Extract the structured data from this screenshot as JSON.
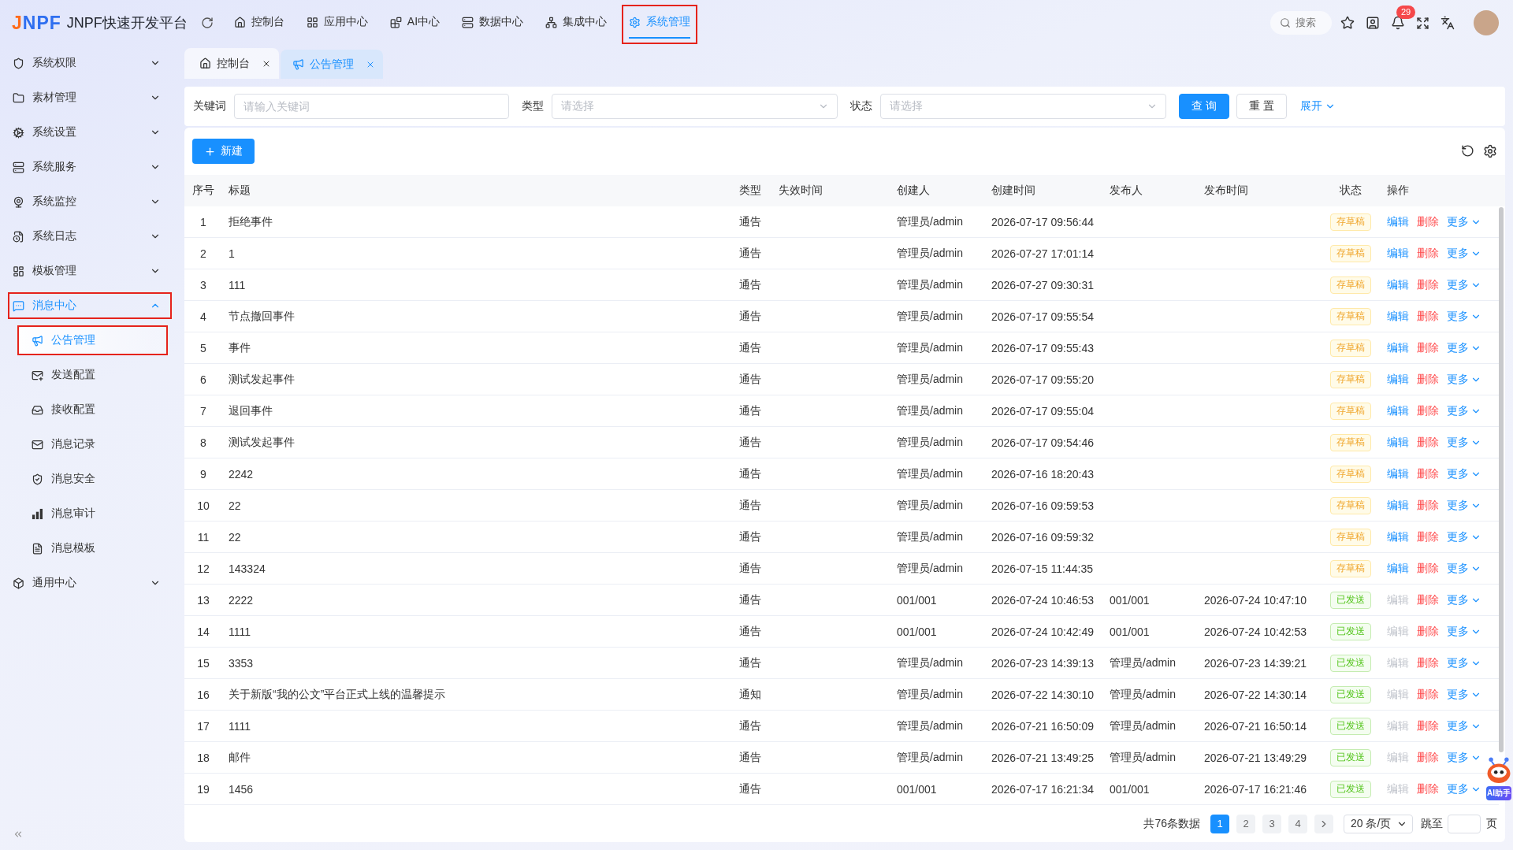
{
  "header": {
    "logo": "JNPF",
    "title": "JNPF快速开发平台",
    "nav": [
      {
        "label": "控制台",
        "selected": false,
        "highlighted": false
      },
      {
        "label": "应用中心",
        "selected": false,
        "highlighted": false
      },
      {
        "label": "AI中心",
        "selected": false,
        "highlighted": false
      },
      {
        "label": "数据中心",
        "selected": false,
        "highlighted": false
      },
      {
        "label": "集成中心",
        "selected": false,
        "highlighted": false
      },
      {
        "label": "系统管理",
        "selected": true,
        "highlighted": true
      }
    ],
    "search": {
      "label": "搜索"
    },
    "notification_count": "29"
  },
  "tabs": [
    {
      "label": "控制台",
      "selected": false
    },
    {
      "label": "公告管理",
      "selected": true
    }
  ],
  "sidebar": {
    "items": [
      {
        "label": "系统权限",
        "selected": false,
        "expanded": false,
        "highlighted": false
      },
      {
        "label": "素材管理",
        "selected": false,
        "expanded": false,
        "highlighted": false
      },
      {
        "label": "系统设置",
        "selected": false,
        "expanded": false,
        "highlighted": false
      },
      {
        "label": "系统服务",
        "selected": false,
        "expanded": false,
        "highlighted": false
      },
      {
        "label": "系统监控",
        "selected": false,
        "expanded": false,
        "highlighted": false
      },
      {
        "label": "系统日志",
        "selected": false,
        "expanded": false,
        "highlighted": false
      },
      {
        "label": "模板管理",
        "selected": false,
        "expanded": false,
        "highlighted": false
      },
      {
        "label": "消息中心",
        "selected": true,
        "expanded": true,
        "highlighted": true,
        "children": [
          {
            "label": "公告管理",
            "selected": true,
            "highlighted": true
          },
          {
            "label": "发送配置",
            "selected": false,
            "highlighted": false
          },
          {
            "label": "接收配置",
            "selected": false,
            "highlighted": false
          },
          {
            "label": "消息记录",
            "selected": false,
            "highlighted": false
          },
          {
            "label": "消息安全",
            "selected": false,
            "highlighted": false
          },
          {
            "label": "消息审计",
            "selected": false,
            "highlighted": false
          },
          {
            "label": "消息模板",
            "selected": false,
            "highlighted": false
          }
        ]
      },
      {
        "label": "通用中心",
        "selected": false,
        "expanded": false,
        "highlighted": false
      }
    ]
  },
  "filters": {
    "fields": [
      {
        "kind": "input",
        "label": "关键词",
        "placeholder": "请输入关键词"
      },
      {
        "kind": "select",
        "label": "类型",
        "placeholder": "请选择"
      },
      {
        "kind": "select",
        "label": "状态",
        "placeholder": "请选择"
      }
    ],
    "buttons": [
      {
        "kind": "primary",
        "label": "查 询"
      },
      {
        "kind": "default",
        "label": "重 置"
      }
    ],
    "expand": "展开"
  },
  "toolbar": {
    "new_button": "新建"
  },
  "table": {
    "columns": [
      "序号",
      "标题",
      "类型",
      "失效时间",
      "创建人",
      "创建时间",
      "发布人",
      "发布时间",
      "状态",
      "操作"
    ],
    "rows": [
      {
        "no": "1",
        "title": "拒绝事件",
        "type": "通告",
        "creator": "管理员/admin",
        "created": "2026-07-17 09:56:44",
        "status": {
          "label": "存草稿",
          "kind": "draft"
        },
        "edit": {
          "label": "编辑",
          "disabled": false
        },
        "delete": "删除",
        "more": "更多"
      },
      {
        "no": "2",
        "title": "1",
        "type": "通告",
        "creator": "管理员/admin",
        "created": "2026-07-27 17:01:14",
        "status": {
          "label": "存草稿",
          "kind": "draft"
        },
        "edit": {
          "label": "编辑",
          "disabled": false
        },
        "delete": "删除",
        "more": "更多"
      },
      {
        "no": "3",
        "title": "111",
        "type": "通告",
        "creator": "管理员/admin",
        "created": "2026-07-27 09:30:31",
        "status": {
          "label": "存草稿",
          "kind": "draft"
        },
        "edit": {
          "label": "编辑",
          "disabled": false
        },
        "delete": "删除",
        "more": "更多"
      },
      {
        "no": "4",
        "title": "节点撤回事件",
        "type": "通告",
        "creator": "管理员/admin",
        "created": "2026-07-17 09:55:54",
        "status": {
          "label": "存草稿",
          "kind": "draft"
        },
        "edit": {
          "label": "编辑",
          "disabled": false
        },
        "delete": "删除",
        "more": "更多"
      },
      {
        "no": "5",
        "title": "事件",
        "type": "通告",
        "creator": "管理员/admin",
        "created": "2026-07-17 09:55:43",
        "status": {
          "label": "存草稿",
          "kind": "draft"
        },
        "edit": {
          "label": "编辑",
          "disabled": false
        },
        "delete": "删除",
        "more": "更多"
      },
      {
        "no": "6",
        "title": "测试发起事件",
        "type": "通告",
        "creator": "管理员/admin",
        "created": "2026-07-17 09:55:20",
        "status": {
          "label": "存草稿",
          "kind": "draft"
        },
        "edit": {
          "label": "编辑",
          "disabled": false
        },
        "delete": "删除",
        "more": "更多"
      },
      {
        "no": "7",
        "title": "退回事件",
        "type": "通告",
        "creator": "管理员/admin",
        "created": "2026-07-17 09:55:04",
        "status": {
          "label": "存草稿",
          "kind": "draft"
        },
        "edit": {
          "label": "编辑",
          "disabled": false
        },
        "delete": "删除",
        "more": "更多"
      },
      {
        "no": "8",
        "title": "测试发起事件",
        "type": "通告",
        "creator": "管理员/admin",
        "created": "2026-07-17 09:54:46",
        "status": {
          "label": "存草稿",
          "kind": "draft"
        },
        "edit": {
          "label": "编辑",
          "disabled": false
        },
        "delete": "删除",
        "more": "更多"
      },
      {
        "no": "9",
        "title": "2242",
        "type": "通告",
        "creator": "管理员/admin",
        "created": "2026-07-16 18:20:43",
        "status": {
          "label": "存草稿",
          "kind": "draft"
        },
        "edit": {
          "label": "编辑",
          "disabled": false
        },
        "delete": "删除",
        "more": "更多"
      },
      {
        "no": "10",
        "title": "22",
        "type": "通告",
        "creator": "管理员/admin",
        "created": "2026-07-16 09:59:53",
        "status": {
          "label": "存草稿",
          "kind": "draft"
        },
        "edit": {
          "label": "编辑",
          "disabled": false
        },
        "delete": "删除",
        "more": "更多"
      },
      {
        "no": "11",
        "title": "22",
        "type": "通告",
        "creator": "管理员/admin",
        "created": "2026-07-16 09:59:32",
        "status": {
          "label": "存草稿",
          "kind": "draft"
        },
        "edit": {
          "label": "编辑",
          "disabled": false
        },
        "delete": "删除",
        "more": "更多"
      },
      {
        "no": "12",
        "title": "143324",
        "type": "通告",
        "creator": "管理员/admin",
        "created": "2026-07-15 11:44:35",
        "status": {
          "label": "存草稿",
          "kind": "draft"
        },
        "edit": {
          "label": "编辑",
          "disabled": false
        },
        "delete": "删除",
        "more": "更多"
      },
      {
        "no": "13",
        "title": "2222",
        "type": "通告",
        "creator": "001/001",
        "created": "2026-07-24 10:46:53",
        "publisher": "001/001",
        "published": "2026-07-24 10:47:10",
        "status": {
          "label": "已发送",
          "kind": "sent"
        },
        "edit": {
          "label": "编辑",
          "disabled": true
        },
        "delete": "删除",
        "more": "更多"
      },
      {
        "no": "14",
        "title": "1111",
        "type": "通告",
        "creator": "001/001",
        "created": "2026-07-24 10:42:49",
        "publisher": "001/001",
        "published": "2026-07-24 10:42:53",
        "status": {
          "label": "已发送",
          "kind": "sent"
        },
        "edit": {
          "label": "编辑",
          "disabled": true
        },
        "delete": "删除",
        "more": "更多"
      },
      {
        "no": "15",
        "title": "3353",
        "type": "通告",
        "creator": "管理员/admin",
        "created": "2026-07-23 14:39:13",
        "publisher": "管理员/admin",
        "published": "2026-07-23 14:39:21",
        "status": {
          "label": "已发送",
          "kind": "sent"
        },
        "edit": {
          "label": "编辑",
          "disabled": true
        },
        "delete": "删除",
        "more": "更多"
      },
      {
        "no": "16",
        "title": "关于新版“我的公文”平台正式上线的温馨提示",
        "type": "通知",
        "creator": "管理员/admin",
        "created": "2026-07-22 14:30:10",
        "publisher": "管理员/admin",
        "published": "2026-07-22 14:30:14",
        "status": {
          "label": "已发送",
          "kind": "sent"
        },
        "edit": {
          "label": "编辑",
          "disabled": true
        },
        "delete": "删除",
        "more": "更多"
      },
      {
        "no": "17",
        "title": "1111",
        "type": "通告",
        "creator": "管理员/admin",
        "created": "2026-07-21 16:50:09",
        "publisher": "管理员/admin",
        "published": "2026-07-21 16:50:14",
        "status": {
          "label": "已发送",
          "kind": "sent"
        },
        "edit": {
          "label": "编辑",
          "disabled": true
        },
        "delete": "删除",
        "more": "更多"
      },
      {
        "no": "18",
        "title": "邮件",
        "type": "通告",
        "creator": "管理员/admin",
        "created": "2026-07-21 13:49:25",
        "publisher": "管理员/admin",
        "published": "2026-07-21 13:49:29",
        "status": {
          "label": "已发送",
          "kind": "sent"
        },
        "edit": {
          "label": "编辑",
          "disabled": true
        },
        "delete": "删除",
        "more": "更多"
      },
      {
        "no": "19",
        "title": "1456",
        "type": "通告",
        "creator": "001/001",
        "created": "2026-07-17 16:21:34",
        "publisher": "001/001",
        "published": "2026-07-17 16:21:46",
        "status": {
          "label": "已发送",
          "kind": "sent"
        },
        "edit": {
          "label": "编辑",
          "disabled": true
        },
        "delete": "删除",
        "more": "更多"
      }
    ]
  },
  "pagination": {
    "total": "共76条数据",
    "pages": [
      {
        "label": "1",
        "selected": true
      },
      {
        "label": "2",
        "selected": false
      },
      {
        "label": "3",
        "selected": false
      },
      {
        "label": "4",
        "selected": false
      }
    ],
    "page_size": "20 条/页",
    "jump_label": "跳至",
    "jump_unit": "页"
  },
  "assistant": {
    "label": "AI助手"
  }
}
